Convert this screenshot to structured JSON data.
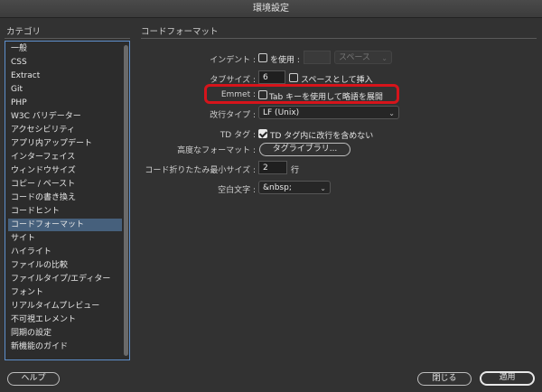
{
  "window": {
    "title": "環境設定"
  },
  "sidebar": {
    "heading": "カテゴリ",
    "items": [
      {
        "label": "一般"
      },
      {
        "label": "CSS"
      },
      {
        "label": "Extract"
      },
      {
        "label": "Git"
      },
      {
        "label": "PHP"
      },
      {
        "label": "W3C バリデーター"
      },
      {
        "label": "アクセシビリティ"
      },
      {
        "label": "アプリ内アップデート"
      },
      {
        "label": "インターフェイス"
      },
      {
        "label": "ウィンドウサイズ"
      },
      {
        "label": "コピー / ペースト"
      },
      {
        "label": "コードの書き換え"
      },
      {
        "label": "コードヒント"
      },
      {
        "label": "コードフォーマット"
      },
      {
        "label": "サイト"
      },
      {
        "label": "ハイライト"
      },
      {
        "label": "ファイルの比較"
      },
      {
        "label": "ファイルタイプ/エディター"
      },
      {
        "label": "フォント"
      },
      {
        "label": "リアルタイムプレビュー"
      },
      {
        "label": "不可視エレメント"
      },
      {
        "label": "同期の設定"
      },
      {
        "label": "新機能のガイド"
      }
    ],
    "selected": "コードフォーマット"
  },
  "main": {
    "heading": "コードフォーマット",
    "indent": {
      "label": "インデント :",
      "checkbox_label": "を使用 :",
      "checked": false,
      "size_value": "",
      "unit_value": "スペース"
    },
    "tab_size": {
      "label": "タブサイズ :",
      "value": "6",
      "checkbox_label": "スペースとして挿入",
      "checked": false
    },
    "emmet": {
      "label": "Emmet :",
      "checkbox_label": "Tab キーを使用して略語を展開",
      "checked": false
    },
    "line_break": {
      "label": "改行タイプ :",
      "value": "LF (Unix)"
    },
    "td_tag": {
      "label": "TD タグ :",
      "checkbox_label": "TD タグ内に改行を含めない",
      "checked": true
    },
    "advanced": {
      "label": "高度なフォーマット :",
      "button_label": "タグライブラリ..."
    },
    "wrap": {
      "label": "コード折りたたみ最小サイズ :",
      "value": "2",
      "unit": "行"
    },
    "whitespace": {
      "label": "空白文字 :",
      "value": "&nbsp;"
    }
  },
  "footer": {
    "help_label": "ヘルプ",
    "close_label": "閉じる",
    "apply_label": "適用"
  },
  "colors": {
    "highlight_border": "#d6141b",
    "selection": "#46607c",
    "sidebar_border": "#5e8fcb"
  }
}
